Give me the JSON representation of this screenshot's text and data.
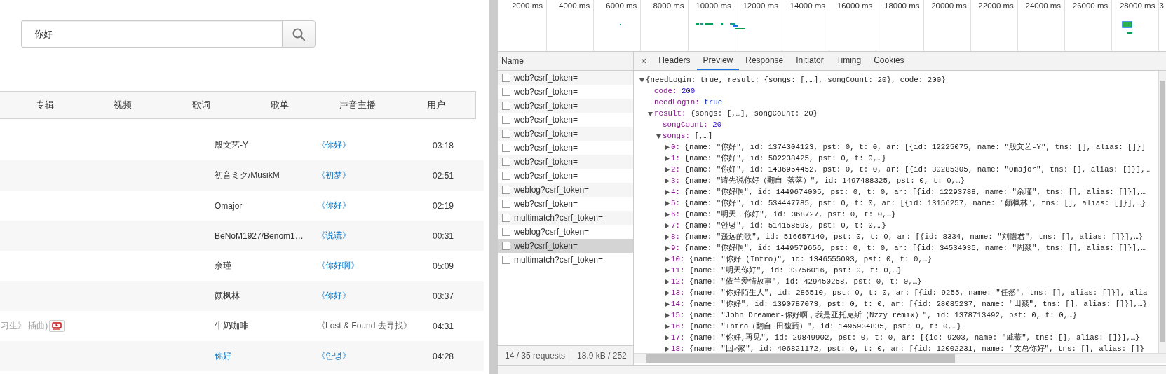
{
  "search": {
    "value": "你好"
  },
  "category_tabs": [
    "专辑",
    "视频",
    "歌词",
    "歌单",
    "声音主播",
    "用户"
  ],
  "songs": [
    {
      "artist": "殷文艺-Y",
      "artist_link": false,
      "album": "《你好》",
      "album_link": true,
      "duration": "03:18"
    },
    {
      "artist": "初音ミク/MusikM",
      "artist_link": false,
      "album": "《初梦》",
      "album_link": true,
      "duration": "02:51"
    },
    {
      "artist": "Omajor",
      "artist_link": false,
      "album": "《你好》",
      "album_link": true,
      "duration": "02:19"
    },
    {
      "artist": "BeNoM1927/Benom1…",
      "artist_link": false,
      "album": "《说谎》",
      "album_link": true,
      "duration": "00:31"
    },
    {
      "artist": "余瑾",
      "artist_link": false,
      "album": "《你好啊》",
      "album_link": true,
      "duration": "05:09"
    },
    {
      "artist": "颜枫林",
      "artist_link": false,
      "album": "《你好》",
      "album_link": true,
      "duration": "03:37"
    },
    {
      "title": "习生》 插曲)",
      "mv": true,
      "artist": "牛奶咖啡",
      "artist_link": false,
      "album": "《Lost & Found 去寻找》",
      "album_link": false,
      "duration": "04:31"
    },
    {
      "artist": "你好",
      "artist_link": true,
      "album": "《안녕》",
      "album_link": true,
      "duration": "04:28"
    }
  ],
  "devtools": {
    "timeline_ticks": [
      "2000 ms",
      "4000 ms",
      "6000 ms",
      "8000 ms",
      "10000 ms",
      "12000 ms",
      "14000 ms",
      "16000 ms",
      "18000 ms",
      "20000 ms",
      "22000 ms",
      "24000 ms",
      "26000 ms",
      "28000 ms",
      "3"
    ],
    "name_header": "Name",
    "requests": [
      {
        "name": "web?csrf_token=",
        "selected": false
      },
      {
        "name": "web?csrf_token=",
        "selected": false
      },
      {
        "name": "web?csrf_token=",
        "selected": false
      },
      {
        "name": "web?csrf_token=",
        "selected": false
      },
      {
        "name": "web?csrf_token=",
        "selected": false
      },
      {
        "name": "web?csrf_token=",
        "selected": false
      },
      {
        "name": "web?csrf_token=",
        "selected": false
      },
      {
        "name": "web?csrf_token=",
        "selected": false
      },
      {
        "name": "weblog?csrf_token=",
        "selected": false
      },
      {
        "name": "web?csrf_token=",
        "selected": false
      },
      {
        "name": "multimatch?csrf_token=",
        "selected": false
      },
      {
        "name": "weblog?csrf_token=",
        "selected": false
      },
      {
        "name": "web?csrf_token=",
        "selected": true
      },
      {
        "name": "multimatch?csrf_token=",
        "selected": false
      }
    ],
    "status": [
      "14 / 35 requests",
      "18.9 kB / 252"
    ],
    "close": "×",
    "detail_tabs": [
      {
        "label": "Headers",
        "selected": false
      },
      {
        "label": "Preview",
        "selected": true
      },
      {
        "label": "Response",
        "selected": false
      },
      {
        "label": "Initiator",
        "selected": false
      },
      {
        "label": "Timing",
        "selected": false
      },
      {
        "label": "Cookies",
        "selected": false
      }
    ],
    "preview": [
      {
        "value": "{needLogin: true, result: {songs: [,…], songCount: 20}, code: 200}",
        "kind": "summary",
        "expanded": true,
        "children": [
          {
            "key": "code:",
            "value": "200",
            "kind": "number"
          },
          {
            "key": "needLogin:",
            "value": "true",
            "kind": "boolean"
          },
          {
            "key": "result:",
            "value": "{songs: [,…], songCount: 20}",
            "kind": "summary",
            "expanded": true,
            "children": [
              {
                "key": "songCount:",
                "value": "20",
                "kind": "number"
              },
              {
                "key": "songs:",
                "value": "[,…]",
                "kind": "summary",
                "expanded": true,
                "children": [
                  {
                    "key": "0:",
                    "value": "{name: \"你好\", id: 1374304123, pst: 0, t: 0, ar: [{id: 12225075, name: \"殷文艺-Y\", tns: [], alias: []}]",
                    "kind": "summary",
                    "expanded": false
                  },
                  {
                    "key": "1:",
                    "value": "{name: \"你好\", id: 502238425, pst: 0, t: 0,…}",
                    "kind": "summary",
                    "expanded": false
                  },
                  {
                    "key": "2:",
                    "value": "{name: \"你好\", id: 1436954452, pst: 0, t: 0, ar: [{id: 30285305, name: \"Omajor\", tns: [], alias: []}],…",
                    "kind": "summary",
                    "expanded": false
                  },
                  {
                    "key": "3:",
                    "value": "{name: \"请先说你好（翻自 落落）\", id: 1497488325, pst: 0, t: 0,…}",
                    "kind": "summary",
                    "expanded": false
                  },
                  {
                    "key": "4:",
                    "value": "{name: \"你好啊\", id: 1449674005, pst: 0, t: 0, ar: [{id: 12293788, name: \"余瑾\", tns: [], alias: []}],…",
                    "kind": "summary",
                    "expanded": false
                  },
                  {
                    "key": "5:",
                    "value": "{name: \"你好\", id: 534447785, pst: 0, t: 0, ar: [{id: 13156257, name: \"颜枫林\", tns: [], alias: []}],…}",
                    "kind": "summary",
                    "expanded": false
                  },
                  {
                    "key": "6:",
                    "value": "{name: \"明天，你好\", id: 368727, pst: 0, t: 0,…}",
                    "kind": "summary",
                    "expanded": false
                  },
                  {
                    "key": "7:",
                    "value": "{name: \"안녕\", id: 514158593, pst: 0, t: 0,…}",
                    "kind": "summary",
                    "expanded": false
                  },
                  {
                    "key": "8:",
                    "value": "{name: \"遥远的歌\", id: 516657140, pst: 0, t: 0, ar: [{id: 8334, name: \"刘惜君\", tns: [], alias: []}],…}",
                    "kind": "summary",
                    "expanded": false
                  },
                  {
                    "key": "9:",
                    "value": "{name: \"你好啊\", id: 1449579656, pst: 0, t: 0, ar: [{id: 34534035, name: \"周燚\", tns: [], alias: []}],…",
                    "kind": "summary",
                    "expanded": false
                  },
                  {
                    "key": "10:",
                    "value": "{name: \"你好 (Intro)\", id: 1346555093, pst: 0, t: 0,…}",
                    "kind": "summary",
                    "expanded": false
                  },
                  {
                    "key": "11:",
                    "value": "{name: \"明天你好\", id: 33756016, pst: 0, t: 0,…}",
                    "kind": "summary",
                    "expanded": false
                  },
                  {
                    "key": "12:",
                    "value": "{name: \"依兰爱情故事\", id: 429450258, pst: 0, t: 0,…}",
                    "kind": "summary",
                    "expanded": false
                  },
                  {
                    "key": "13:",
                    "value": "{name: \"你好陌生人\", id: 286510, pst: 0, t: 0, ar: [{id: 9255, name: \"任然\", tns: [], alias: []}], alia",
                    "kind": "summary",
                    "expanded": false
                  },
                  {
                    "key": "14:",
                    "value": "{name: \"你好\", id: 1390787073, pst: 0, t: 0, ar: [{id: 28085237, name: \"田燚\", tns: [], alias: []}],…}",
                    "kind": "summary",
                    "expanded": false
                  },
                  {
                    "key": "15:",
                    "value": "{name: \"John Dreamer-你好啊，我是亚托克斯（Nzzy remix）\", id: 1378713492, pst: 0, t: 0,…}",
                    "kind": "summary",
                    "expanded": false
                  },
                  {
                    "key": "16:",
                    "value": "{name: \"Intro（翻自 田馥甄）\", id: 1495934835, pst: 0, t: 0,…}",
                    "kind": "summary",
                    "expanded": false
                  },
                  {
                    "key": "17:",
                    "value": "{name: \"你好,再见\", id: 29849902, pst: 0, t: 0, ar: [{id: 9203, name: \"戚薇\", tns: [], alias: []}],…}",
                    "kind": "summary",
                    "expanded": false
                  },
                  {
                    "key": "18:",
                    "value": "{name: \"回♂家\", id: 406821172, pst: 0, t: 0, ar: [{id: 12002231, name: \"文总你好\", tns: [], alias: []}",
                    "kind": "summary",
                    "expanded": false
                  }
                ]
              }
            ]
          }
        ]
      }
    ]
  }
}
